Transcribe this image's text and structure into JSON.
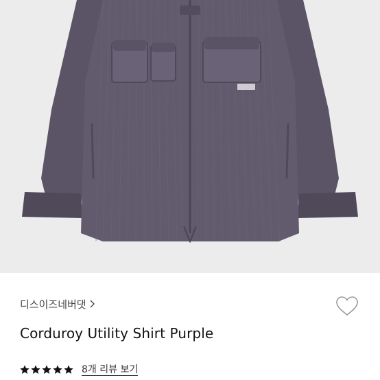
{
  "product": {
    "image_alt": "corduroy-utility-shirt-photo",
    "brand": "디스이즈네버댓",
    "title": "Corduroy Utility Shirt Purple",
    "rating": 5,
    "review_link": "8개 리뷰 보기"
  },
  "icons": {
    "wishlist": "heart-outline-icon",
    "brand_chevron": "chevron-right-icon",
    "star": "star-icon"
  },
  "colors": {
    "garment": "#5d5668",
    "image_bg": "#ececec",
    "star": "#111111"
  }
}
